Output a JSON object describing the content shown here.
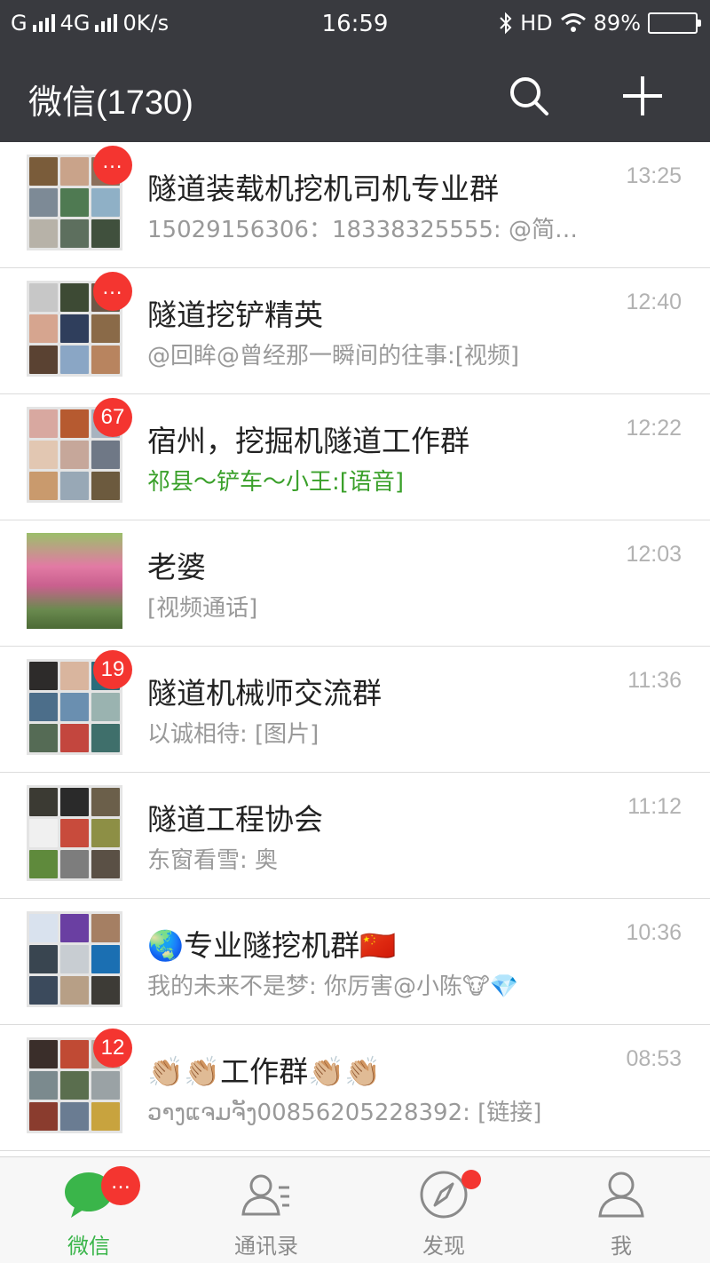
{
  "status_bar": {
    "carrier_left": "G",
    "network": "4G",
    "speed": "0K/s",
    "time": "16:59",
    "hd": "HD",
    "battery": "89%",
    "battery_level": 0.89
  },
  "header": {
    "title": "微信(1730)",
    "search_icon": "search-icon",
    "add_icon": "plus-icon",
    "background": "#393a3f"
  },
  "chats": [
    {
      "name": "隧道装载机挖机司机专业群",
      "preview": "15029156306：18338325555: @简…",
      "time": "13:25",
      "badge": "…",
      "avatar": [
        "#7a5c3a",
        "#c9a38a",
        "#8b6f5a",
        "#7d8a96",
        "#4f7a52",
        "#8fb0c6",
        "#b7b2a8",
        "#5d6f5e",
        "#40503d"
      ]
    },
    {
      "name": "隧道挖铲精英",
      "preview": "@回眸@曾经那一瞬间的往事:[视频]",
      "time": "12:40",
      "badge": "…",
      "avatar": [
        "#c7c7c7",
        "#3d4a34",
        "#6e5847",
        "#d6a58f",
        "#2f3e5c",
        "#8a6a48",
        "#5a4232",
        "#8aa6c5",
        "#b8845f"
      ]
    },
    {
      "name": "宿州，挖掘机隧道工作群",
      "preview": "祁县～铲车～小王:[语音]",
      "preview_green": true,
      "time": "12:22",
      "badge": "67",
      "avatar": [
        "#d8a8a0",
        "#b65a30",
        "#a7b3bf",
        "#e2c7b2",
        "#c6a79a",
        "#6f7886",
        "#c99a6d",
        "#98a8b6",
        "#6c5a3e"
      ]
    },
    {
      "name": "老婆",
      "preview": "[视频通话]",
      "time": "12:03",
      "badge": "",
      "avatar": [
        "#6a8a4f"
      ]
    },
    {
      "name": "隧道机械师交流群",
      "preview": "以诚相待: [图片]",
      "time": "11:36",
      "badge": "19",
      "avatar": [
        "#2d2b2a",
        "#d9b59e",
        "#2a6d7c",
        "#4c6e8a",
        "#6a8fb0",
        "#9ab3b0",
        "#556b55",
        "#c3463e",
        "#3f6f6b"
      ]
    },
    {
      "name": "隧道工程协会",
      "preview": "东窗看雪: 奥",
      "time": "11:12",
      "badge": "",
      "avatar": [
        "#3b3a33",
        "#2a2a2a",
        "#6b5f4a",
        "#f0f0f0",
        "#c84b3c",
        "#8d8f45",
        "#5f8a3c",
        "#7d7d7d",
        "#5a5045"
      ]
    },
    {
      "name": "🌏专业隧挖机群🇨🇳",
      "preview": "我的未来不是梦: 你厉害@小陈🐮💎",
      "time": "10:36",
      "badge": "",
      "avatar": [
        "#d9e2ee",
        "#6a3fa2",
        "#a57f63",
        "#394550",
        "#c8cdd2",
        "#1b6fb2",
        "#3b4a5c",
        "#b79f86",
        "#3d3b36"
      ]
    },
    {
      "name": "👏🏼👏🏼工作群👏🏼👏🏼",
      "preview": "ວາງແຈມຈັງ00856205228392: [链接]",
      "time": "08:53",
      "badge": "12",
      "avatar": [
        "#3a2e2a",
        "#c04a34",
        "#b5b0a8",
        "#7b8a8e",
        "#5a6e4e",
        "#9aa2a5",
        "#8a3c2e",
        "#6a7c92",
        "#c8a33e"
      ]
    }
  ],
  "tabs": [
    {
      "label": "微信",
      "icon": "chat-bubble-icon",
      "active": true,
      "badge": "…"
    },
    {
      "label": "通讯录",
      "icon": "contacts-icon",
      "active": false
    },
    {
      "label": "发现",
      "icon": "compass-icon",
      "active": false,
      "dot": true
    },
    {
      "label": "我",
      "icon": "person-icon",
      "active": false
    }
  ],
  "colors": {
    "accent_green": "#3ab54a",
    "badge_red": "#f43530"
  }
}
